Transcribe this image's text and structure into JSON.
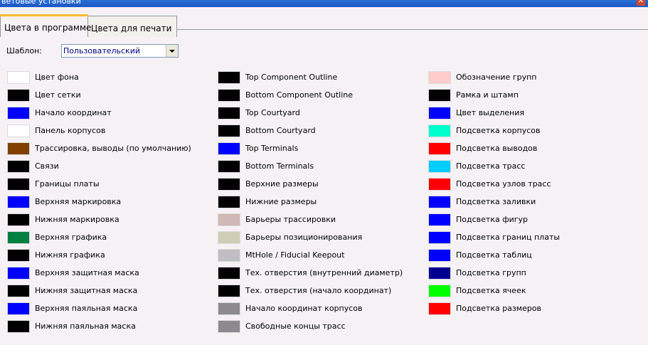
{
  "window": {
    "title": "ветовые установки",
    "close_icon": "close-icon"
  },
  "tabs": [
    {
      "label": "Цвета в программе",
      "active": true
    },
    {
      "label": "Цвета для печати",
      "active": false
    }
  ],
  "template": {
    "label": "Шаблон:",
    "value": "Пользовательский",
    "dropdown_icon": "chevron-down-icon"
  },
  "columns": [
    [
      {
        "label": "Цвет фона",
        "color": "#ffffff"
      },
      {
        "label": "Цвет сетки",
        "color": "#000000"
      },
      {
        "label": "Начало координат",
        "color": "#0000ff"
      },
      {
        "label": "Панель корпусов",
        "color": "#ffffff"
      },
      {
        "label": "Трассировка, выводы (по умолчанию)",
        "color": "#804000"
      },
      {
        "label": "Связи",
        "color": "#000000"
      },
      {
        "label": "Границы платы",
        "color": "#000000"
      },
      {
        "label": "Верхняя маркировка",
        "color": "#0000ff"
      },
      {
        "label": "Нижняя маркировка",
        "color": "#000000"
      },
      {
        "label": "Верхняя графика",
        "color": "#008040"
      },
      {
        "label": "Нижняя графика",
        "color": "#000000"
      },
      {
        "label": "Верхняя защитная маска",
        "color": "#0000ff"
      },
      {
        "label": "Нижняя защитная маска",
        "color": "#000000"
      },
      {
        "label": "Верхняя паяльная маска",
        "color": "#0000ff"
      },
      {
        "label": "Нижняя паяльная маска",
        "color": "#000000"
      }
    ],
    [
      {
        "label": "Top Component Outline",
        "color": "#000000"
      },
      {
        "label": "Bottom Component Outline",
        "color": "#000000"
      },
      {
        "label": "Top Courtyard",
        "color": "#000000"
      },
      {
        "label": "Bottom Courtyard",
        "color": "#000000"
      },
      {
        "label": "Top Terminals",
        "color": "#0000ff"
      },
      {
        "label": "Bottom Terminals",
        "color": "#000000"
      },
      {
        "label": "Верхние размеры",
        "color": "#000000"
      },
      {
        "label": "Нижние размеры",
        "color": "#000000"
      },
      {
        "label": "Барьеры трассировки",
        "color": "#cfb8b5"
      },
      {
        "label": "Барьеры позиционирования",
        "color": "#cfcdb6"
      },
      {
        "label": "MtHole / Fiducial Keepout",
        "color": "#c0bec2"
      },
      {
        "label": "Тех. отверстия (внутренний диаметр)",
        "color": "#000000"
      },
      {
        "label": "Тех. отверстия (начало координат)",
        "color": "#000000"
      },
      {
        "label": "Начало координат корпусов",
        "color": "#8c8a8e"
      },
      {
        "label": "Свободные концы трасс",
        "color": "#8c8a8e"
      }
    ],
    [
      {
        "label": "Обозначение групп",
        "color": "#ffcccc"
      },
      {
        "label": "Рамка и штамп",
        "color": "#000000"
      },
      {
        "label": "Цвет выделения",
        "color": "#0000ff"
      },
      {
        "label": "Подсветка корпусов",
        "color": "#00ffcc"
      },
      {
        "label": "Подсветка выводов",
        "color": "#ff0000"
      },
      {
        "label": "Подсветка трасс",
        "color": "#00ccff"
      },
      {
        "label": "Подсветка узлов трасс",
        "color": "#ff0000"
      },
      {
        "label": "Подсветка заливки",
        "color": "#0000ff"
      },
      {
        "label": "Подсветка фигур",
        "color": "#0000ff"
      },
      {
        "label": "Подсветка границ платы",
        "color": "#0000ff"
      },
      {
        "label": "Подсветка таблиц",
        "color": "#0000ff"
      },
      {
        "label": "Подсветка групп",
        "color": "#000090"
      },
      {
        "label": "Подсветка ячеек",
        "color": "#00ff00"
      },
      {
        "label": "Подсветка размеров",
        "color": "#ff0000"
      }
    ]
  ]
}
